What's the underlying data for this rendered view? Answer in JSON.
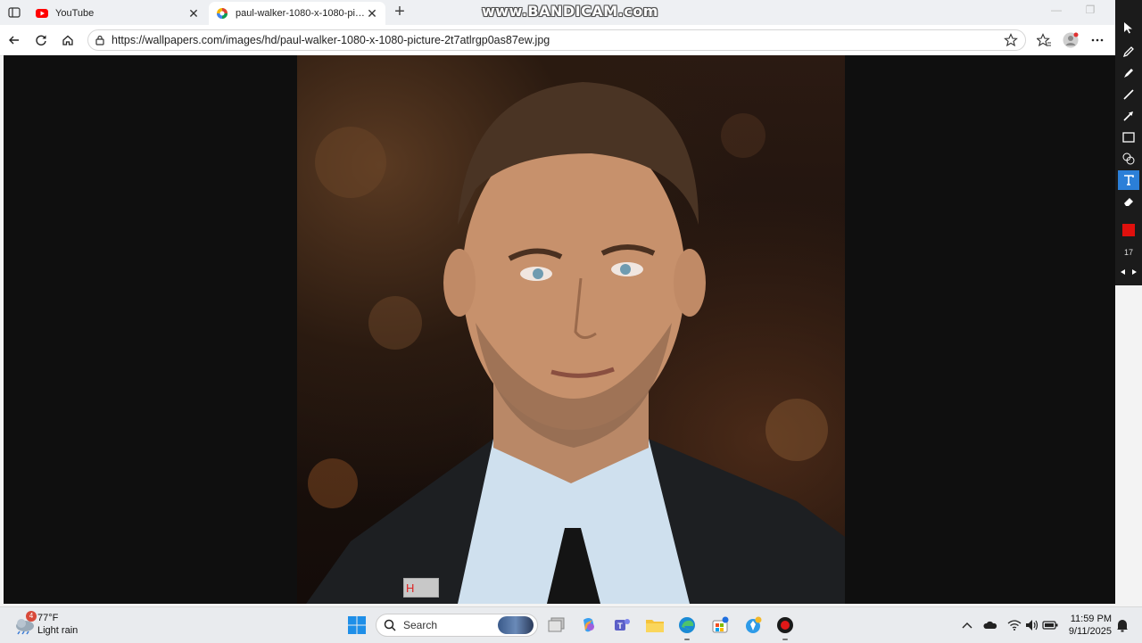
{
  "browser": {
    "tabs": [
      {
        "title": "YouTube",
        "favicon": "youtube-icon",
        "active": false
      },
      {
        "title": "paul-walker-1080-x-1080-picture",
        "favicon": "wallpapers-icon",
        "active": true
      }
    ],
    "url": "https://wallpapers.com/images/hd/paul-walker-1080-x-1080-picture-2t7atlrgp0as87ew.jpg"
  },
  "watermark": "www.BANDICAM.com",
  "content": {
    "text_box_value": "H"
  },
  "draw_panel": {
    "brush_size": "17",
    "color": "#e0100d"
  },
  "taskbar": {
    "weather": {
      "temp": "77°F",
      "desc": "Light rain",
      "badge": "4"
    },
    "search_label": "Search",
    "time": "11:59 PM",
    "date": "9/11/2025"
  }
}
